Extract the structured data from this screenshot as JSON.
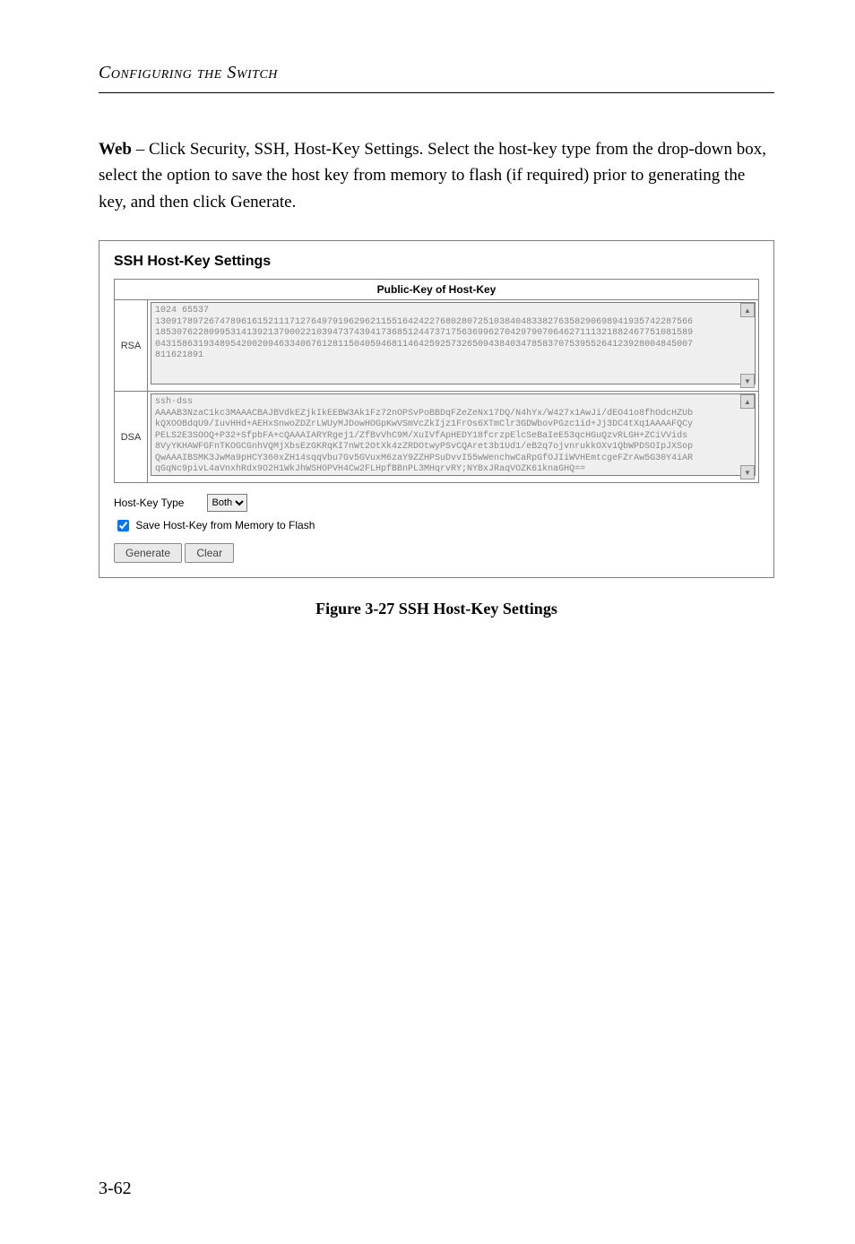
{
  "running_head": "Configuring the Switch",
  "body_html": "Web – Click Security, SSH, Host-Key Settings. Select the host-key type from the drop-down box, select the option to save the host key from memory to flash (if required) prior to generating the key, and then click Generate.",
  "panel": {
    "title": "SSH Host-Key Settings",
    "pk_header": "Public-Key of Host-Key",
    "rsa_label": "RSA",
    "dsa_label": "DSA",
    "rsa_value": "1024 65537\n1309178972674789616152111712764979196296211551642422768028072510384048338276358290698941935742287566\n1853076228099531413921379002210394737439417368512447371756369962704297907064627111321882467751081589\n0431586319348954200209463340676128115040594681146425925732650943840347858370753955264123928004845007\n811621891",
    "dsa_value": "ssh-dss\nAAAAB3NzaC1kc3MAAACBAJBVdkEZjkIkEEBW3Ak1Fz72nOPSvPoBBDqFZeZeNx17DQ/N4hYx/W427x1AwJi/dEO41o8fhOdcHZUb\nkQXOOBdqU9/IuvHHd+AEHxSnwoZDZrLWUyMJDowHOGpKwVSmVcZkIjz1FrOs6XTmClr3GDWbovPGzc1id+Jj3DC4tXq1AAAAFQCy\nPELS2E3SOOQ+P32+SfpbFA+cQAAAIARYRgej1/ZfBvVhC9M/XuIVfApHEDY18fcrzpElcSeBaIeE53qcHGuQzvRLGH+ZCiVVids\n8VyYKHAWFGFnTKOGCGnhVQMjXbsEzGKRqKI7nWt2OtXk4zZRDOtwyPSvCQAret3b1Ud1/eB2q7ojvnrukkOXv1QbWPDSOIpJXSop\nQwAAAIBSMK3JwMa9pHCY360xZH14sqqVbu7Gv5GVuxM6zaY9ZZHPSuDvvI55wWenchwCaRpGfOJIiWVHEmtcgeFZrAw5G30Y4iAR\nqGqNc9pivL4aVnxhRdx9O2H1WkJhWSHOPVH4Cw2FLHpfBBnPL3MHqrvRY;NYBxJRaqVOZK61knaGHQ==",
    "host_key_type_label": "Host-Key Type",
    "host_key_type_value": "Both",
    "save_label": "Save Host-Key from Memory to Flash",
    "save_checked": true,
    "generate_label": "Generate",
    "clear_label": "Clear"
  },
  "figure_caption": "Figure 3-27  SSH Host-Key Settings",
  "page_number": "3-62"
}
